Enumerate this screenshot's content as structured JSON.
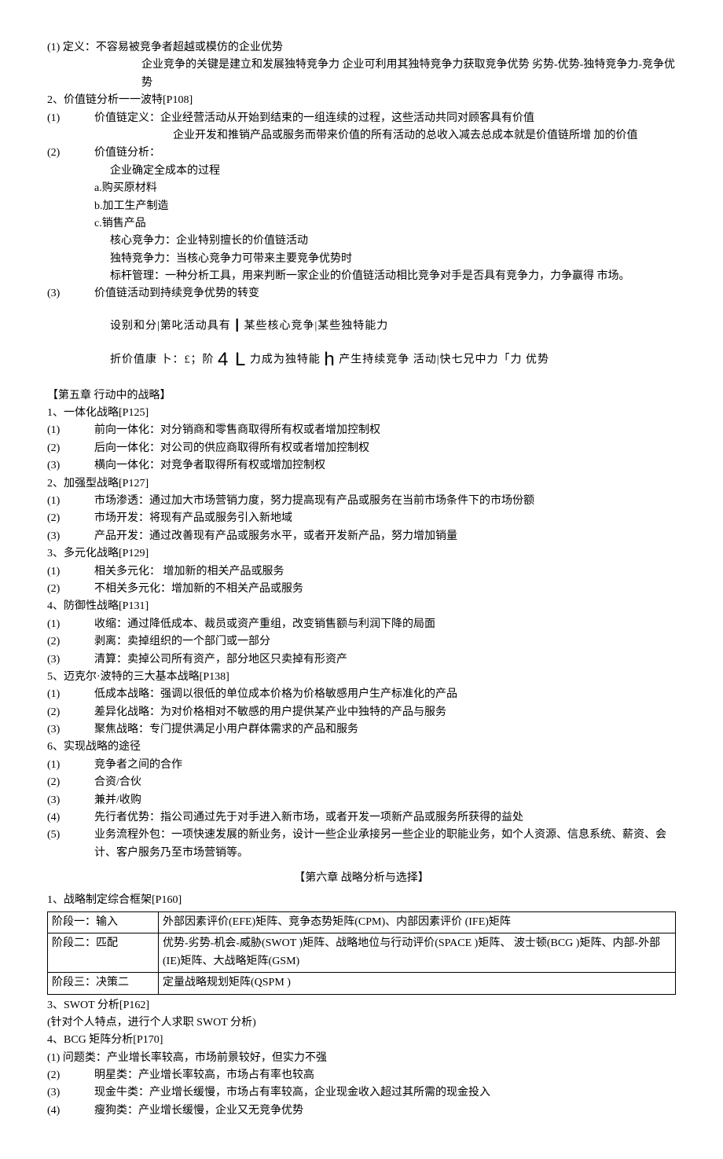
{
  "s1": {
    "i1": {
      "n": "(1) 定义：",
      "t": "不容易被竞争者超越或模仿的企业优势"
    },
    "i1b": "企业竞争的关键是建立和发展独特竞争力 企业可利用其独特竞争力获取竞争优势 劣势-优势-独特竞争力-竞争优势",
    "h2": "2、价值链分析一一波特[P108]",
    "i2_1": {
      "n": "(1)",
      "t": "价值链定义：企业经营活动从开始到结束的一组连续的过程，这些活动共同对顾客具有价值"
    },
    "i2_1b": "企业开发和推销产品或服务而带来价值的所有活动的总收入减去总成本就是价值链所增  加的价值",
    "i2_2": {
      "n": "(2)",
      "t": "价值链分析："
    },
    "i2_2a": "企业确定全成本的过程",
    "a": "a.购买原材料",
    "b": "b.加工生产制造",
    "c": "c.销售产品",
    "core": "核心竞争力：企业特别擅长的价值链活动",
    "uniq": "独特竞争力：当核心竞争力可带来主要竞争优势时",
    "bench": "标杆管理：一种分析工具，用来判断一家企业的价值链活动相比竞争对手是否具有竞争力，力争赢得  市场。",
    "i2_3": {
      "n": "(3)",
      "t": "价值链活动到持续竞争优势的转变"
    },
    "g1": "设别和分|第叱活动具有",
    "g1b": "某些核心竞争|某些独特能力",
    "g2": "折价值康  卜：£；阶",
    "g2b": "力成为独特能",
    "g2c": "产生持续竞争  活动|快七兄中力「力    优势"
  },
  "ch5": {
    "title": "【第五章 行动中的战略】",
    "h1": "1、一体化战略[P125]",
    "i1_1": {
      "n": "(1)",
      "t": "前向一体化：对分销商和零售商取得所有权或者增加控制权"
    },
    "i1_2": {
      "n": "(2)",
      "t": "后向一体化：对公司的供应商取得所有权或者增加控制权"
    },
    "i1_3": {
      "n": "(3)",
      "t": "横向一体化：对竞争者取得所有权或增加控制权"
    },
    "h2": "2、加强型战略[P127]",
    "i2_1": {
      "n": "(1)",
      "t": "市场渗透：通过加大市场营销力度，努力提高现有产品或服务在当前市场条件下的市场份额"
    },
    "i2_2": {
      "n": "(2)",
      "t": "市场开发：将现有产品或服务引入新地域"
    },
    "i2_3": {
      "n": "(3)",
      "t": "产品开发：通过改善现有产品或服务水平，或者开发新产品，努力增加销量"
    },
    "h3": "3、多元化战略[P129]",
    "i3_1": {
      "n": "(1)",
      "t": "相关多元化：    增加新的相关产品或服务"
    },
    "i3_2": {
      "n": "(2)",
      "t": "不相关多元化：增加新的不相关产品或服务"
    },
    "h4": "4、防御性战略[P131]",
    "i4_1": {
      "n": "(1)",
      "t": "收缩：通过降低成本、裁员或资产重组，改变销售额与利润下降的局面"
    },
    "i4_2": {
      "n": "(2)",
      "t": "剥离：卖掉组织的一个部门或一部分"
    },
    "i4_3": {
      "n": "(3)",
      "t": "清算：卖掉公司所有资产，部分地区只卖掉有形资产"
    },
    "h5": "5、迈克尔·波特的三大基本战略[P138]",
    "i5_1": {
      "n": "(1)",
      "t": "低成本战略：强调以很低的单位成本价格为价格敏感用户生产标准化的产品"
    },
    "i5_2": {
      "n": "(2)",
      "t": "差异化战略：为对价格相对不敏感的用户提供某产业中独特的产品与服务"
    },
    "i5_3": {
      "n": "(3)",
      "t": "聚焦战略：专门提供满足小用户群体需求的产品和服务"
    },
    "h6": "6、实现战略的途径",
    "i6_1": {
      "n": "(1)",
      "t": "竞争者之间的合作"
    },
    "i6_2": {
      "n": "(2)",
      "t": "合资/合伙"
    },
    "i6_3": {
      "n": "(3)",
      "t": "兼并/收购"
    },
    "i6_4": {
      "n": "(4)",
      "t": "先行者优势：指公司通过先于对手进入新市场，或者开发一项新产品或服务所获得的益处"
    },
    "i6_5": {
      "n": "(5)",
      "t": "业务流程外包：一项快速发展的新业务，设计一些企业承接另一些企业的职能业务，如个人资源、信息系统、薪资、会计、客户服务乃至市场营销等。"
    }
  },
  "ch6": {
    "title": "【第六章    战略分析与选择】",
    "h1": "1、战略制定综合框架[P160]",
    "tbl": {
      "r1a": "阶段一：输入",
      "r1b": "外部因素评价(EFE)矩阵、竞争态势矩阵(CPM)、内部因素评价 (IFE)矩阵",
      "r2a": "阶段二：匹配",
      "r2b": "优势-劣势-机会-威胁(SWOT )矩阵、战略地位与行动评价(SPACE )矩阵、  波士顿(BCG )矩阵、内部-外部(IE)矩阵、大战略矩阵(GSM)",
      "r3a": "阶段三：决策二",
      "r3b": "定量战略规划矩阵(QSPM )"
    },
    "h3": "3、SWOT 分析[P162]",
    "h3b": "(针对个人特点，进行个人求职              SWOT 分析)",
    "h4": "4、BCG 矩阵分析[P170]",
    "i4_1": "(1) 问题类：产业增长率较高，市场前景较好，但实力不强",
    "i4_2": {
      "n": "(2)",
      "t": "明星类：产业增长率较高，市场占有率也较高"
    },
    "i4_3": {
      "n": "(3)",
      "t": "现金牛类：产业增长缓慢，市场占有率较高，企业现金收入超过其所需的现金投入"
    },
    "i4_4": {
      "n": "(4)",
      "t": "瘦狗类：产业增长缓慢，企业又无竞争优势"
    }
  }
}
